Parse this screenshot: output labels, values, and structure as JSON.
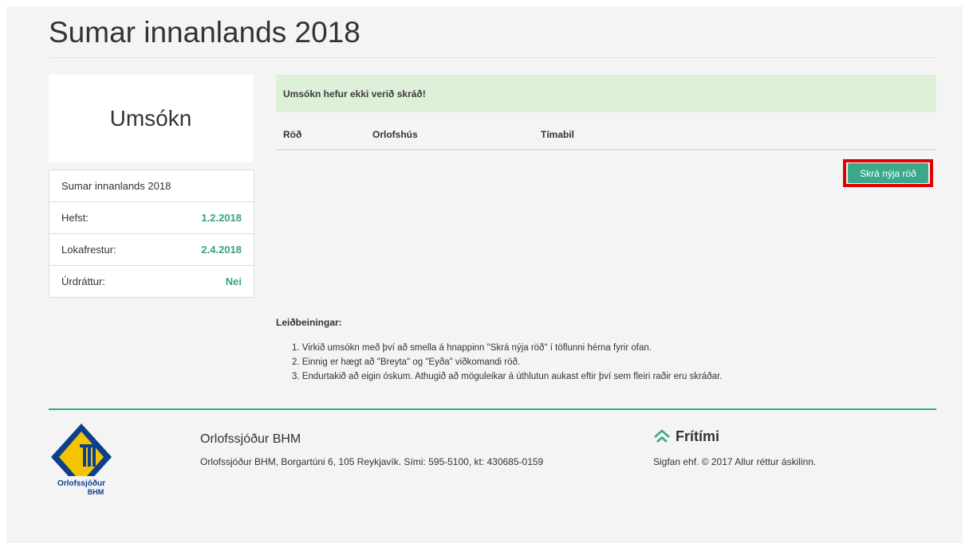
{
  "page": {
    "title": "Sumar innanlands 2018"
  },
  "sidebar": {
    "heading": "Umsókn",
    "rows": [
      {
        "label": "Sumar innanlands 2018",
        "value": ""
      },
      {
        "label": "Hefst:",
        "value": "1.2.2018"
      },
      {
        "label": "Lokafrestur:",
        "value": "2.4.2018"
      },
      {
        "label": "Úrdráttur:",
        "value": "Nei"
      }
    ]
  },
  "main": {
    "alert": "Umsókn hefur ekki verið skráð!",
    "columns": [
      "Röð",
      "Orlofshús",
      "Tímabil"
    ],
    "add_button": "Skrá nýja röð"
  },
  "guide": {
    "title": "Leiðbeiningar:",
    "items": [
      "1. Virkið umsókn með því að smella á hnappinn \"Skrá nýja röð\" í töflunni hérna fyrir ofan.",
      "2. Einnig er hægt að \"Breyta\" og \"Eyða\" viðkomandi röð.",
      "3. Endurtakið að eigin óskum. Athugið að möguleikar á úthlutun aukast eftir því sem fleiri raðir eru skráðar."
    ]
  },
  "footer": {
    "logo_text_1": "Orlofssjóður",
    "logo_text_2": "BHM",
    "org_name": "Orlofssjóður BHM",
    "address": "Orlofssjóður BHM, Borgartúni 6, 105 Reykjavík.  Sími: 595-5100, kt: 430685-0159",
    "brand": "Frítími",
    "brand_icon": "house-icon",
    "copyright": "Sigfan ehf. © 2017 Allur réttur áskilinn."
  },
  "colors": {
    "accent": "#3aa98a",
    "alert_bg": "#dff0d8",
    "highlight": "#e10000"
  }
}
